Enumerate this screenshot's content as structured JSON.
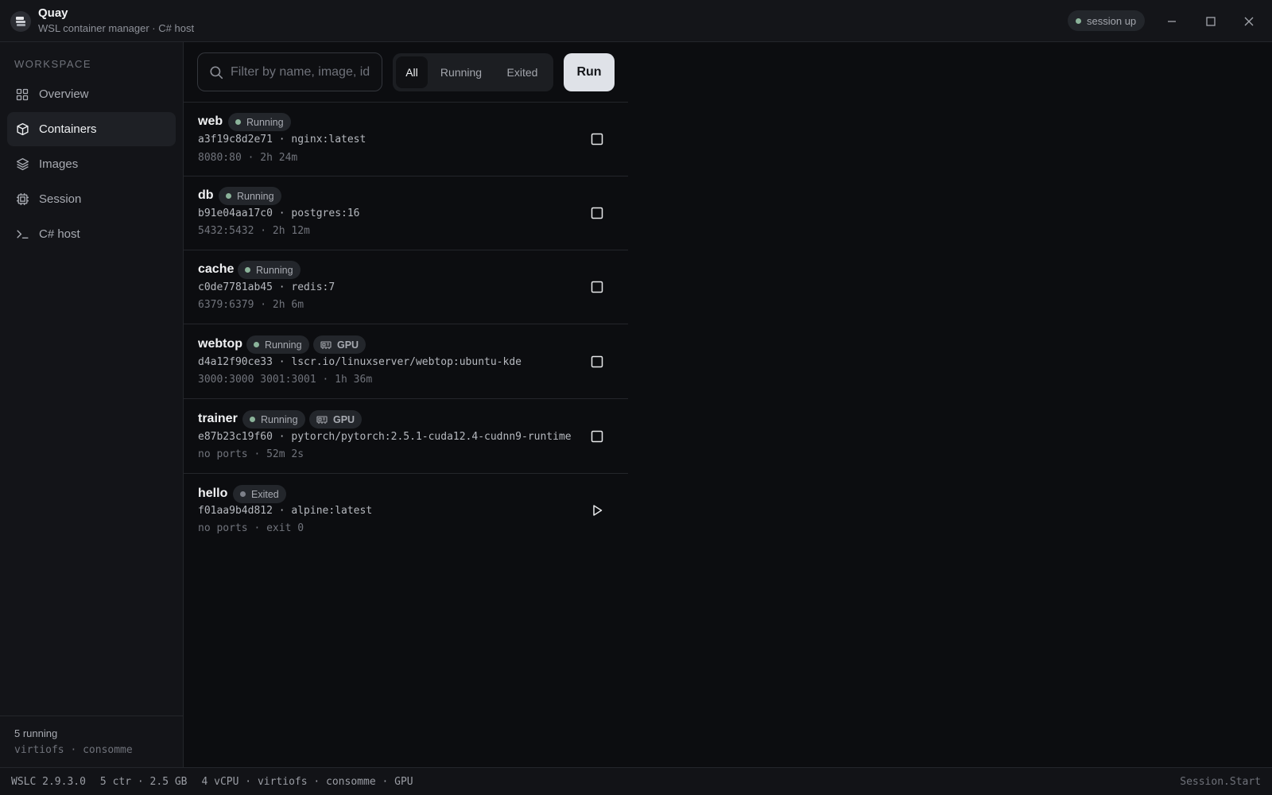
{
  "app": {
    "title": "Quay",
    "subtitle": "WSL container manager · C# host",
    "session_status": "session up"
  },
  "sidebar": {
    "section_label": "WORKSPACE",
    "items": [
      {
        "label": "Overview",
        "icon": "grid-icon"
      },
      {
        "label": "Containers",
        "icon": "cube-icon",
        "active": true
      },
      {
        "label": "Images",
        "icon": "layers-icon"
      },
      {
        "label": "Session",
        "icon": "chip-icon"
      },
      {
        "label": "C# host",
        "icon": "terminal-icon"
      }
    ],
    "footer": {
      "running": "5 running",
      "details": "virtiofs · consomme"
    }
  },
  "toolbar": {
    "search_placeholder": "Filter by name, image, id",
    "filters": [
      "All",
      "Running",
      "Exited"
    ],
    "active_filter": "All",
    "run_label": "Run"
  },
  "containers": [
    {
      "name": "web",
      "status": "Running",
      "gpu": false,
      "id": "a3f19c8d2e71",
      "image": "nginx:latest",
      "meta": "8080:80 · 2h 24m",
      "action": "stop-icon"
    },
    {
      "name": "db",
      "status": "Running",
      "gpu": false,
      "id": "b91e04aa17c0",
      "image": "postgres:16",
      "meta": "5432:5432 · 2h 12m",
      "action": "stop-icon"
    },
    {
      "name": "cache",
      "status": "Running",
      "gpu": false,
      "id": "c0de7781ab45",
      "image": "redis:7",
      "meta": "6379:6379 · 2h 6m",
      "action": "stop-icon"
    },
    {
      "name": "webtop",
      "status": "Running",
      "gpu": true,
      "gpu_label": "GPU",
      "id": "d4a12f90ce33",
      "image": "lscr.io/linuxserver/webtop:ubuntu-kde",
      "meta": "3000:3000 3001:3001 · 1h 36m",
      "action": "stop-icon"
    },
    {
      "name": "trainer",
      "status": "Running",
      "gpu": true,
      "gpu_label": "GPU",
      "id": "e87b23c19f60",
      "image": "pytorch/pytorch:2.5.1-cuda12.4-cudnn9-runtime",
      "meta": "no ports · 52m 2s",
      "action": "stop-icon"
    },
    {
      "name": "hello",
      "status": "Exited",
      "gpu": false,
      "id": "f01aa9b4d812",
      "image": "alpine:latest",
      "meta": "no ports · exit 0",
      "action": "play-icon"
    }
  ],
  "statusbar": {
    "version": "WSLC 2.9.3.0",
    "usage": "5 ctr · 2.5 GB",
    "resources": "4 vCPU · virtiofs · consomme · GPU",
    "right": "Session.Start"
  },
  "colors": {
    "background": "#0c0d10",
    "running_dot": "#8bb39a",
    "run_button": "#dfe2e8"
  }
}
